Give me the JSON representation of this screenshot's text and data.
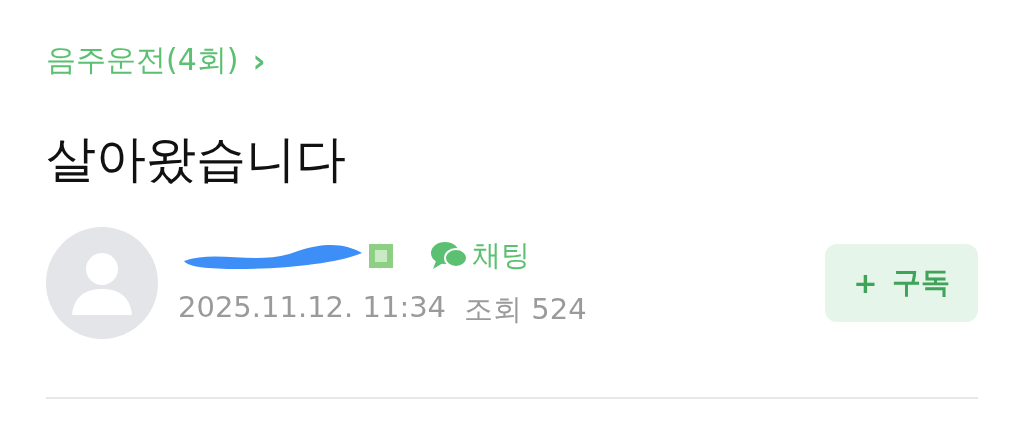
{
  "category": {
    "label": "음주운전(4회)",
    "chevron": "›"
  },
  "title": "살아왔습니다",
  "author": {
    "redacted": true,
    "chat_label": "채팅",
    "date": "2025.11.12. 11:34",
    "views": "조회 524"
  },
  "subscribe": {
    "icon": "+",
    "label": "구독"
  }
}
